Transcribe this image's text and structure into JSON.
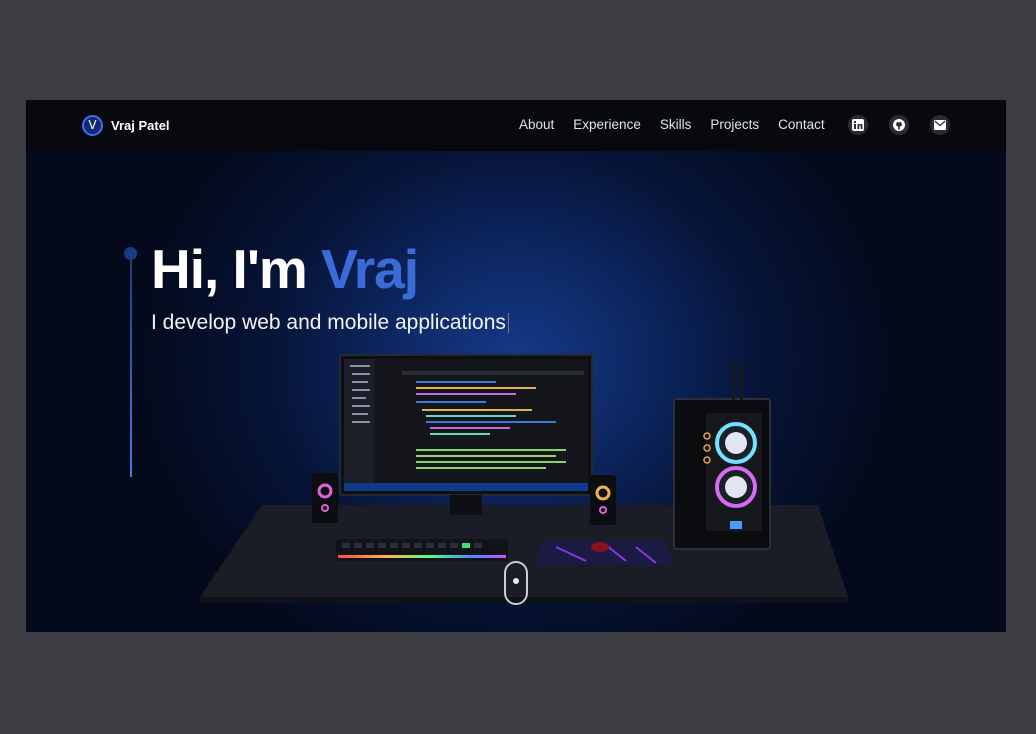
{
  "brand": {
    "logo_letter": "V",
    "name": "Vraj Patel"
  },
  "nav": {
    "links": [
      {
        "label": "About"
      },
      {
        "label": "Experience"
      },
      {
        "label": "Skills"
      },
      {
        "label": "Projects"
      },
      {
        "label": "Contact"
      }
    ]
  },
  "socials": [
    {
      "icon": "linkedin-icon",
      "glyph": "in"
    },
    {
      "icon": "github-icon"
    },
    {
      "icon": "mail-icon"
    }
  ],
  "hero": {
    "greeting": "Hi, I'm ",
    "name": "Vraj",
    "subtitle": "I develop web and mobile applications"
  },
  "colors": {
    "page_bg": "#3d3e43",
    "nav_bg": "#07090f",
    "accent": "#3a6bd6",
    "hero_glow": "#163a88"
  }
}
